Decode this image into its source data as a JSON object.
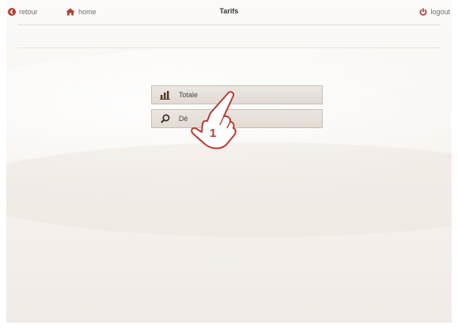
{
  "nav": {
    "back_label": "retour",
    "home_label": "home",
    "title": "Tarifs",
    "logout_label": "logout"
  },
  "menu": {
    "items": [
      {
        "label": "Totale",
        "icon": "bar-chart-icon"
      },
      {
        "label": "Dé",
        "icon": "search-icon"
      }
    ]
  },
  "callout": {
    "number": "1"
  },
  "colors": {
    "accent": "#c0392b",
    "button_bg": "#e6dfd9",
    "button_border": "#c8c0b8"
  }
}
